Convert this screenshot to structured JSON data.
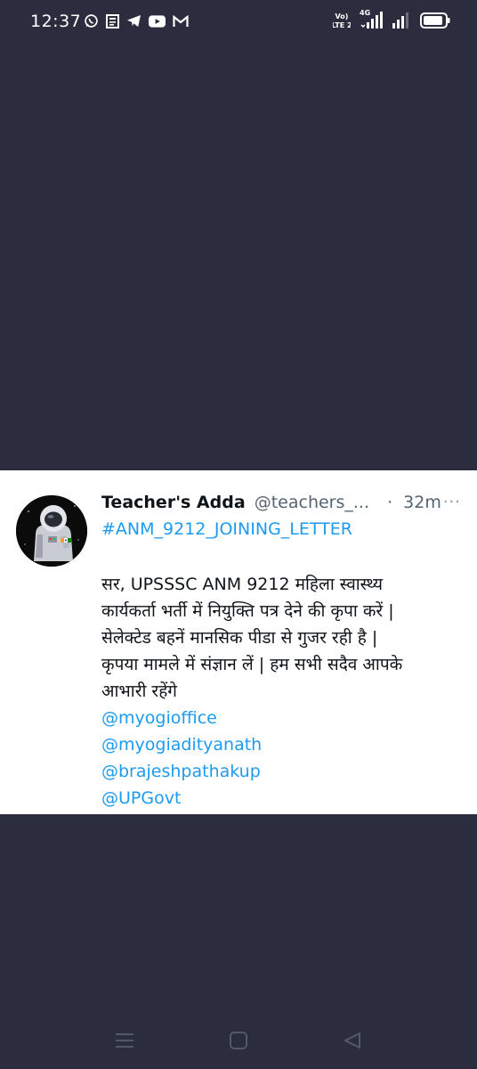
{
  "status_bar": {
    "time": "12:37",
    "volte_label": "Vo) LTE 2",
    "network_type": "4G",
    "notification_icons": [
      "whatsapp-icon",
      "news-icon",
      "telegram-icon",
      "youtube-icon",
      "gmail-icon"
    ]
  },
  "tweet": {
    "display_name": "Teacher's Adda",
    "handle": "@teachers_...",
    "separator": "·",
    "time_ago": "32m",
    "more_label": "···",
    "hashtag": "#ANM_9212_JOINING_LETTER",
    "body_lines": [
      "सर, UPSSSC ANM 9212 महिला स्वास्थ्य",
      "कार्यकर्ता भर्ती में नियुक्ति पत्र देने की कृपा करें |",
      "सेलेक्टेड बहनें मानसिक पीडा से गुजर रही है |",
      "कृपया मामले में संज्ञान लें | हम सभी सदैव आपके",
      "आभारी रहेंगे"
    ],
    "mentions": [
      "@myogioffice",
      "@myogiadityanath",
      "@brajeshpathakup",
      "@UPGovt"
    ]
  },
  "colors": {
    "background": "#2b2d3f",
    "card": "#ffffff",
    "link": "#1d9bf0",
    "muted": "#536471"
  }
}
